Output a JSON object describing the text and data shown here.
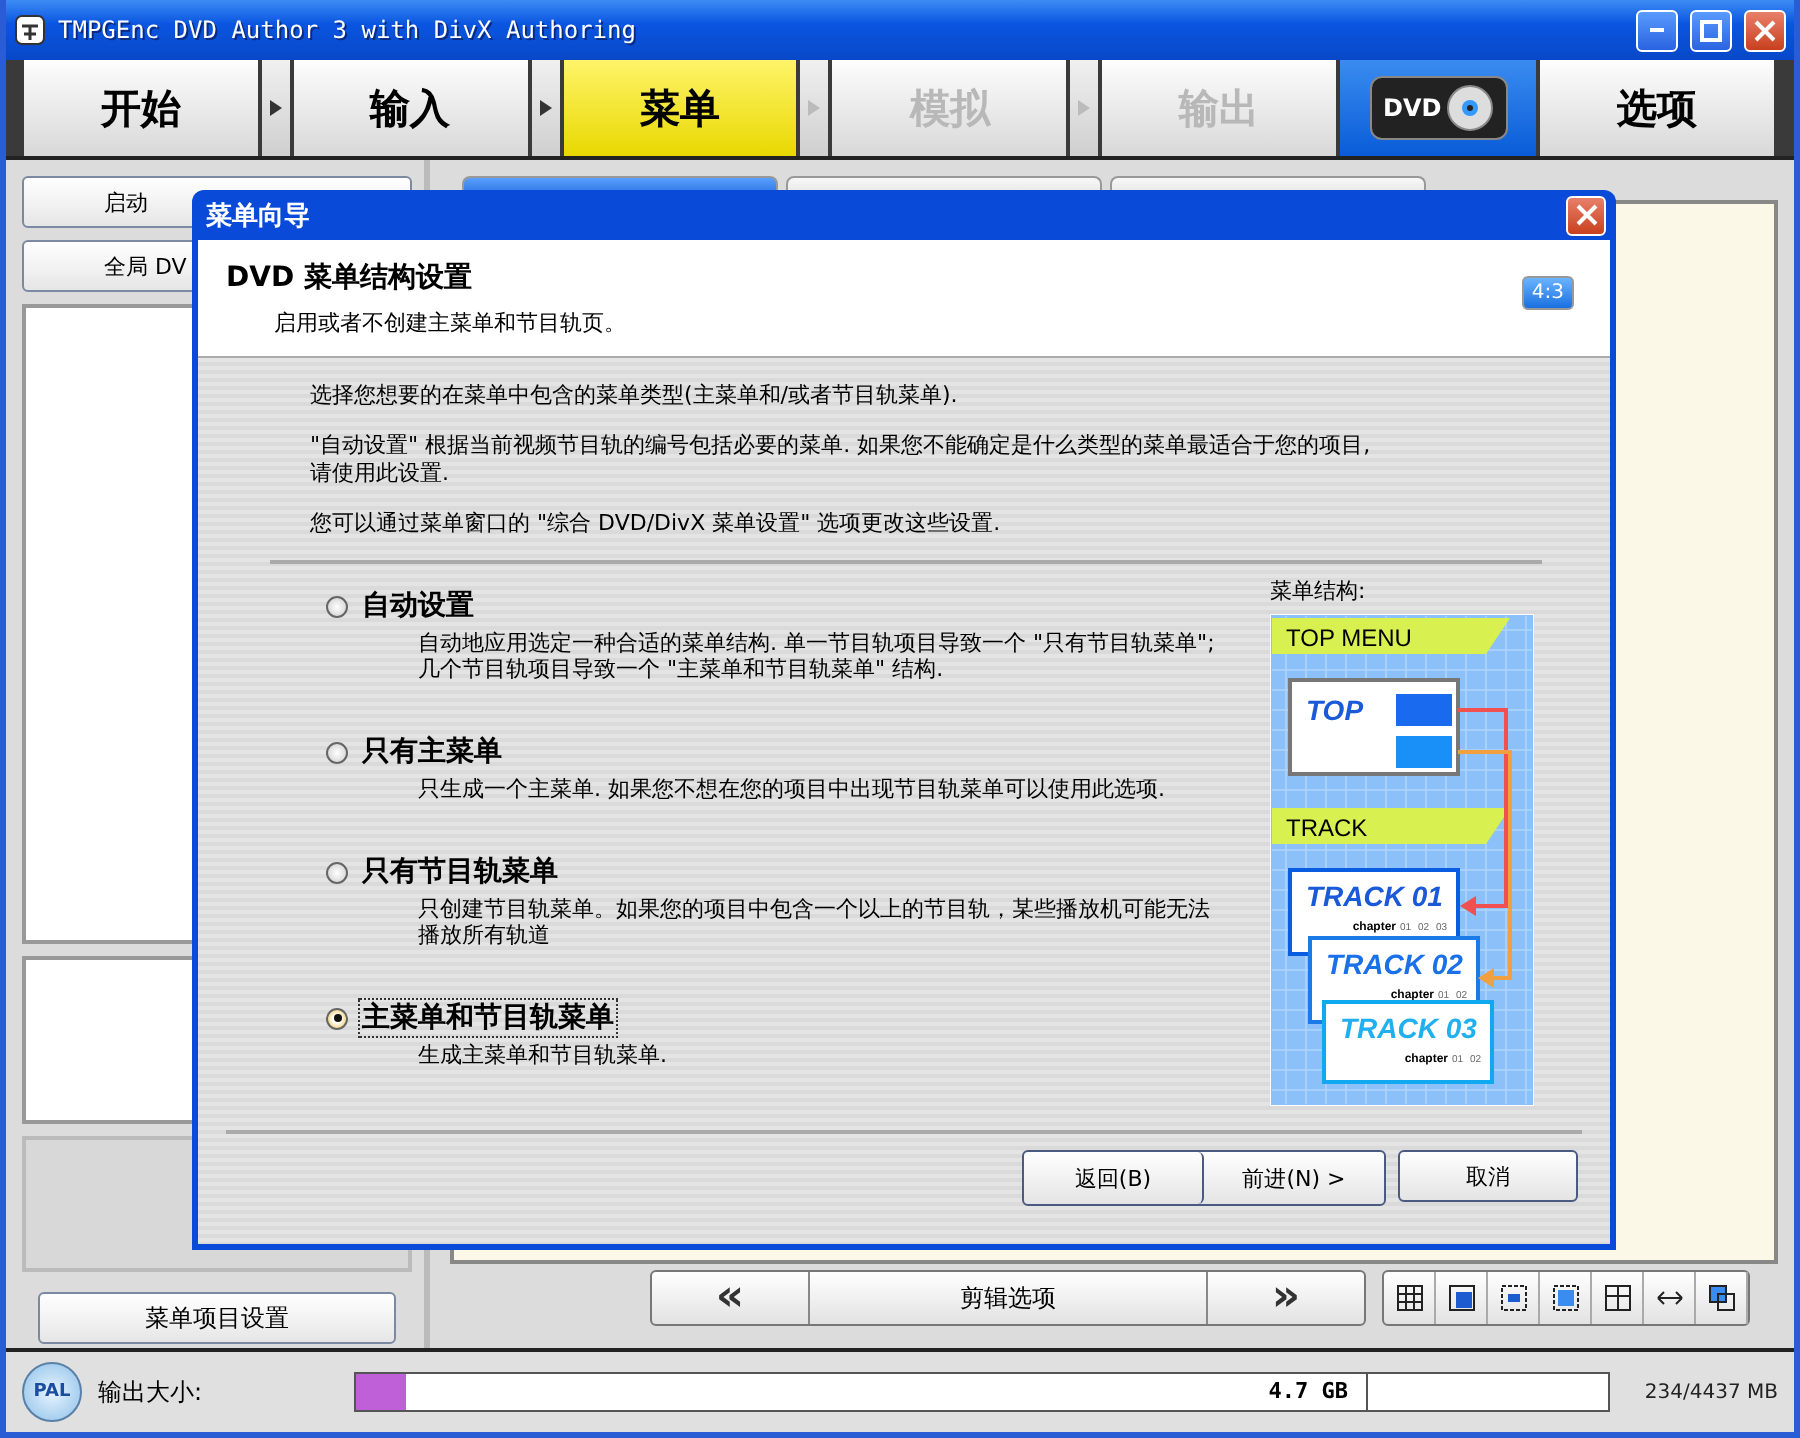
{
  "window": {
    "title": "TMPGEnc DVD Author 3 with DivX Authoring"
  },
  "steps": [
    {
      "kind": "step",
      "label": "开始",
      "selected": false,
      "disabled": false
    },
    {
      "kind": "step",
      "label": "输入",
      "selected": false,
      "disabled": false
    },
    {
      "kind": "step",
      "label": "菜单",
      "selected": true,
      "disabled": false
    },
    {
      "kind": "step",
      "label": "模拟",
      "selected": false,
      "disabled": true
    },
    {
      "kind": "step",
      "label": "输出",
      "selected": false,
      "disabled": true
    },
    {
      "kind": "logo",
      "label": "DVD"
    },
    {
      "kind": "step",
      "label": "选项",
      "selected": false,
      "disabled": false
    }
  ],
  "sidebar": {
    "buttons": [
      "启动",
      "全局 DV"
    ],
    "bottom_button": "菜单项目设置"
  },
  "tabs": [
    {
      "selected": true
    },
    {
      "selected": false
    },
    {
      "selected": false
    }
  ],
  "nav": {
    "prev": "«",
    "label": "剪辑选项",
    "next": "»"
  },
  "status_bar": {
    "format": "PAL",
    "label": "输出大小:",
    "level": 0.04,
    "capacity": "4.7 GB",
    "size": "234/4437 MB"
  },
  "dialog": {
    "title": "菜单向导",
    "heading": "DVD 菜单结构设置",
    "subheading": "启用或者不创建主菜单和节目轨页。",
    "aspect": "4:3",
    "paragraphs": [
      "选择您想要的在菜单中包含的菜单类型(主菜单和/或者节目轨菜单).",
      "\"自动设置\" 根据当前视频节目轨的编号包括必要的菜单. 如果您不能确定是什么类型的菜单最适合于您的项目, 请使用此设置.",
      "您可以通过菜单窗口的 \"综合 DVD/DivX 菜单设置\" 选项更改这些设置."
    ],
    "options": [
      {
        "label": "自动设置",
        "description": "自动地应用选定一种合适的菜单结构. 单一节目轨项目导致一个 \"只有节目轨菜单\"; 几个节目轨项目导致一个 \"主菜单和节目轨菜单\" 结构.",
        "selected": false
      },
      {
        "label": "只有主菜单",
        "description": "只生成一个主菜单. 如果您不想在您的项目中出现节目轨菜单可以使用此选项.",
        "selected": false
      },
      {
        "label": "只有节目轨菜单",
        "description": "只创建节目轨菜单。如果您的项目中包含一个以上的节目轨，某些播放机可能无法播放所有轨道",
        "selected": false
      },
      {
        "label": "主菜单和节目轨菜单",
        "description": "生成主菜单和节目轨菜单.",
        "selected": true
      }
    ],
    "diagram": {
      "caption": "菜单结构:",
      "top_banner": "TOP MENU",
      "top_label": "TOP",
      "track_banner": "TRACK",
      "tracks": [
        {
          "title": "TRACK 01",
          "chapter_label": "chapter",
          "chapters": [
            "01",
            "02",
            "03"
          ]
        },
        {
          "title": "TRACK 02",
          "chapter_label": "chapter",
          "chapters": [
            "01",
            "02"
          ]
        },
        {
          "title": "TRACK 03",
          "chapter_label": "chapter",
          "chapters": [
            "01",
            "02"
          ]
        }
      ]
    },
    "buttons": [
      {
        "kind": "back",
        "label": "返回(B)"
      },
      {
        "kind": "next",
        "label": "前进(N) >"
      },
      {
        "kind": "cancel",
        "label": "取消"
      }
    ]
  }
}
